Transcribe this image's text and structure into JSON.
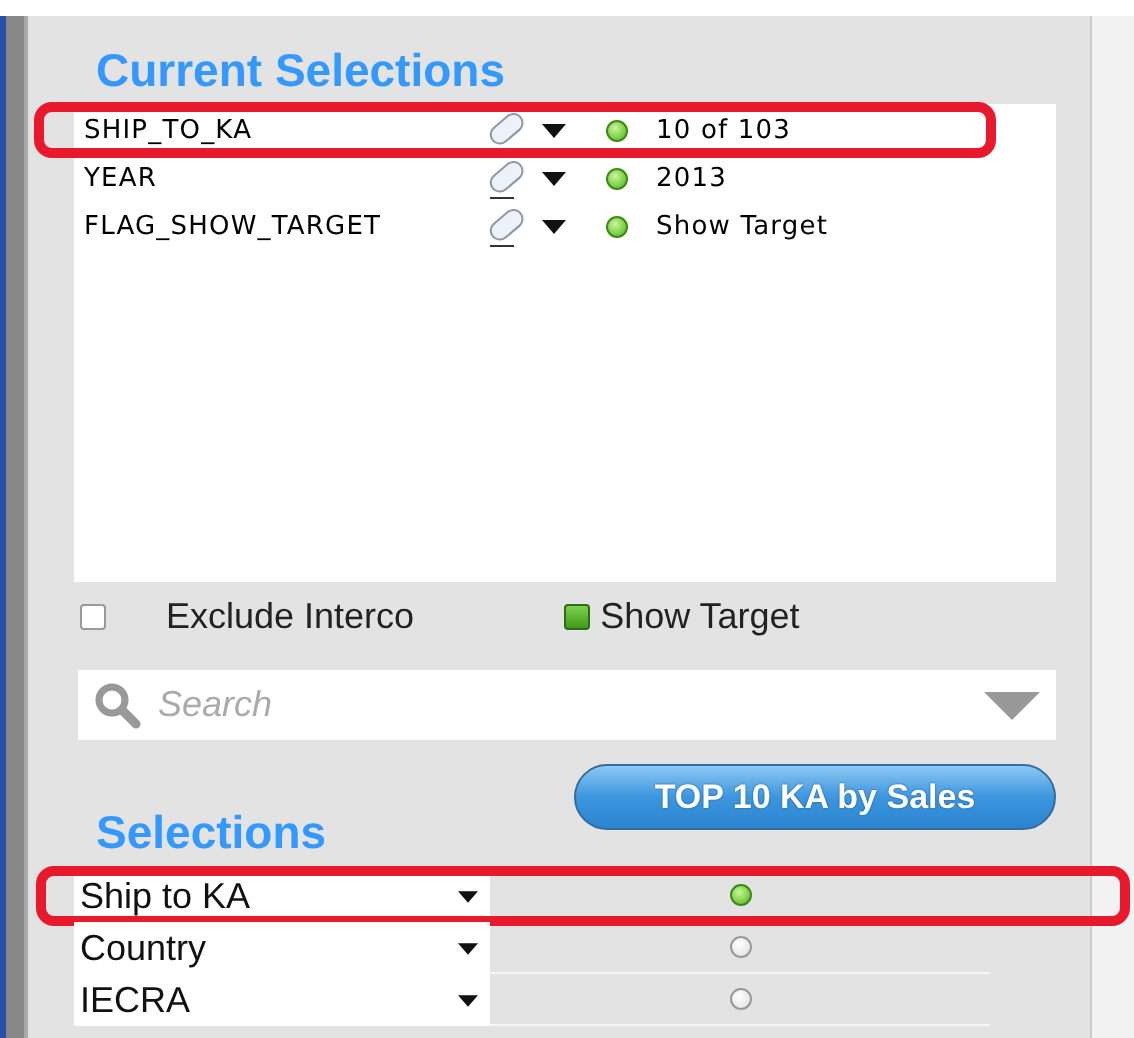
{
  "current_selections": {
    "title": "Current Selections",
    "rows": [
      {
        "field": "SHIP_TO_KA",
        "value": "10 of 103",
        "highlighted": true
      },
      {
        "field": "YEAR",
        "value": "2013",
        "highlighted": false
      },
      {
        "field": "FLAG_SHOW_TARGET",
        "value": "Show Target",
        "highlighted": false
      }
    ]
  },
  "options": [
    {
      "label": "Exclude Interco",
      "checked": false
    },
    {
      "label": "Show Target",
      "checked": true
    }
  ],
  "search": {
    "placeholder": "Search"
  },
  "top_button": "TOP 10 KA by Sales",
  "selections": {
    "title": "Selections",
    "rows": [
      {
        "label": "Ship to KA",
        "has_selection": true,
        "highlighted": true
      },
      {
        "label": "Country",
        "has_selection": false,
        "highlighted": false
      },
      {
        "label": "IECRA",
        "has_selection": false,
        "highlighted": false
      }
    ]
  }
}
